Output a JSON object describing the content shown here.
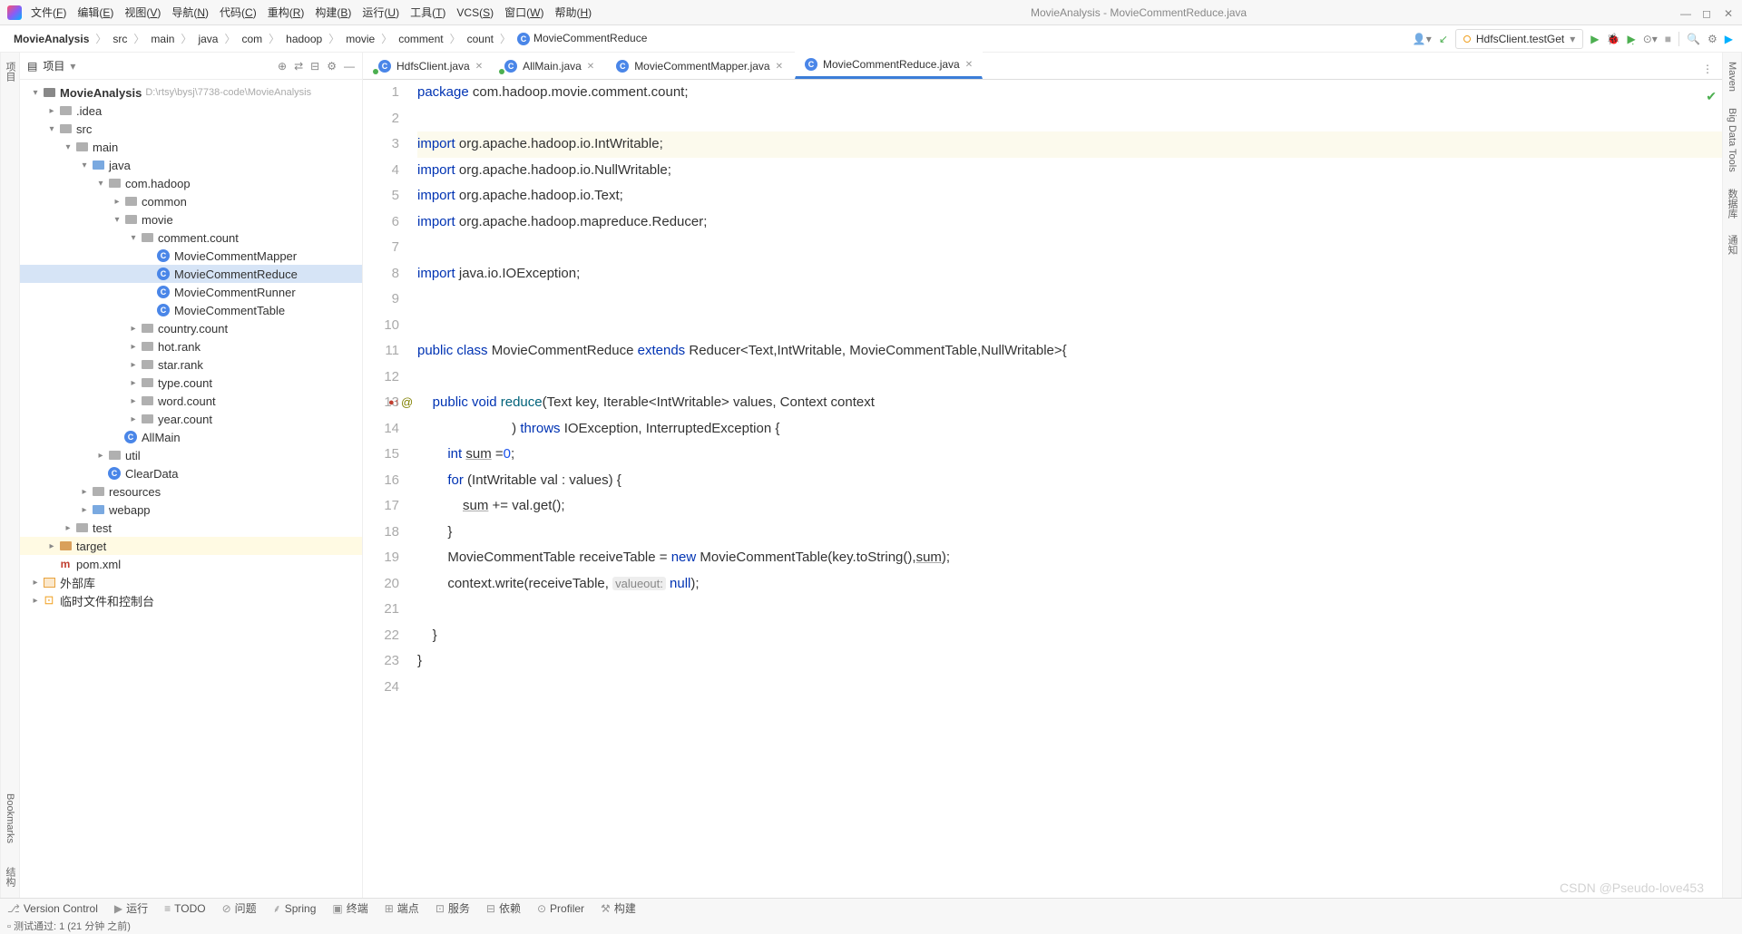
{
  "title": "MovieAnalysis - MovieCommentReduce.java",
  "menu": [
    "文件(F)",
    "编辑(E)",
    "视图(V)",
    "导航(N)",
    "代码(C)",
    "重构(R)",
    "构建(B)",
    "运行(U)",
    "工具(T)",
    "VCS(S)",
    "窗口(W)",
    "帮助(H)"
  ],
  "breadcrumb": [
    "MovieAnalysis",
    "src",
    "main",
    "java",
    "com",
    "hadoop",
    "movie",
    "comment",
    "count",
    "MovieCommentReduce"
  ],
  "runConfig": "HdfsClient.testGet",
  "sidebar": {
    "title": "项目",
    "tree": [
      {
        "d": 0,
        "a": "▾",
        "t": "module",
        "l": "MovieAnalysis",
        "p": "D:\\rtsy\\bysj\\7738-code\\MovieAnalysis",
        "bold": true
      },
      {
        "d": 1,
        "a": "▸",
        "t": "fld",
        "l": ".idea"
      },
      {
        "d": 1,
        "a": "▾",
        "t": "fld",
        "l": "src"
      },
      {
        "d": 2,
        "a": "▾",
        "t": "fld",
        "l": "main"
      },
      {
        "d": 3,
        "a": "▾",
        "t": "fldB",
        "l": "java"
      },
      {
        "d": 4,
        "a": "▾",
        "t": "fld",
        "l": "com.hadoop"
      },
      {
        "d": 5,
        "a": "▸",
        "t": "fld",
        "l": "common"
      },
      {
        "d": 5,
        "a": "▾",
        "t": "fld",
        "l": "movie"
      },
      {
        "d": 6,
        "a": "▾",
        "t": "fld",
        "l": "comment.count"
      },
      {
        "d": 7,
        "a": "",
        "t": "cls",
        "l": "MovieCommentMapper"
      },
      {
        "d": 7,
        "a": "",
        "t": "cls",
        "l": "MovieCommentReduce",
        "sel": true
      },
      {
        "d": 7,
        "a": "",
        "t": "cls",
        "l": "MovieCommentRunner"
      },
      {
        "d": 7,
        "a": "",
        "t": "cls",
        "l": "MovieCommentTable"
      },
      {
        "d": 6,
        "a": "▸",
        "t": "fld",
        "l": "country.count"
      },
      {
        "d": 6,
        "a": "▸",
        "t": "fld",
        "l": "hot.rank"
      },
      {
        "d": 6,
        "a": "▸",
        "t": "fld",
        "l": "star.rank"
      },
      {
        "d": 6,
        "a": "▸",
        "t": "fld",
        "l": "type.count"
      },
      {
        "d": 6,
        "a": "▸",
        "t": "fld",
        "l": "word.count"
      },
      {
        "d": 6,
        "a": "▸",
        "t": "fld",
        "l": "year.count"
      },
      {
        "d": 5,
        "a": "",
        "t": "cls",
        "l": "AllMain"
      },
      {
        "d": 4,
        "a": "▸",
        "t": "fld",
        "l": "util"
      },
      {
        "d": 4,
        "a": "",
        "t": "cls",
        "l": "ClearData"
      },
      {
        "d": 3,
        "a": "▸",
        "t": "fld",
        "l": "resources"
      },
      {
        "d": 3,
        "a": "▸",
        "t": "fldB",
        "l": "webapp"
      },
      {
        "d": 2,
        "a": "▸",
        "t": "fld",
        "l": "test"
      },
      {
        "d": 1,
        "a": "▸",
        "t": "fldO",
        "l": "target",
        "hl": true
      },
      {
        "d": 1,
        "a": "",
        "t": "mvn",
        "l": "pom.xml"
      },
      {
        "d": 0,
        "a": "▸",
        "t": "lib",
        "l": "外部库"
      },
      {
        "d": 0,
        "a": "▸",
        "t": "scratch",
        "l": "临时文件和控制台"
      }
    ]
  },
  "tabs": [
    {
      "l": "HdfsClient.java",
      "run": true
    },
    {
      "l": "AllMain.java",
      "run": true
    },
    {
      "l": "MovieCommentMapper.java"
    },
    {
      "l": "MovieCommentReduce.java",
      "active": true
    }
  ],
  "leftGutter": [
    "项目"
  ],
  "rightGutter": [
    "Maven",
    "Big Data Tools",
    "数据库",
    "通知"
  ],
  "bottomBar": [
    "Version Control",
    "运行",
    "TODO",
    "问题",
    "Spring",
    "终端",
    "端点",
    "服务",
    "依赖",
    "Profiler",
    "构建"
  ],
  "status": "测试通过: 1 (21 分钟 之前)",
  "watermark": "CSDN @Pseudo-love453",
  "code": {
    "1": {
      "pkg": "package",
      "path": " com.hadoop.movie.comment.count;"
    },
    "3": {
      "imp": "import",
      "rest": " org.apache.hadoop.io.IntWritable;"
    },
    "4": {
      "imp": "import",
      "rest": " org.apache.hadoop.io.NullWritable;"
    },
    "5": {
      "imp": "import",
      "rest": " org.apache.hadoop.io.Text;"
    },
    "6": {
      "imp": "import",
      "rest": " org.apache.hadoop.mapreduce.Reducer;"
    },
    "8": {
      "imp": "import",
      "rest": " java.io.IOException;"
    },
    "11": {
      "pub": "public",
      "cls": "class",
      "name": " MovieCommentReduce ",
      "ext": "extends",
      "rest": " Reducer<Text,IntWritable, MovieCommentTable,NullWritable>{"
    },
    "13": {
      "pre": "    ",
      "pub": "public",
      "vd": " void ",
      "name": "reduce",
      "args": "(Text key, Iterable<IntWritable> values, Context context"
    },
    "14": {
      "pre": "                         ) ",
      "thr": "throws",
      "rest": " IOException, InterruptedException {"
    },
    "15": {
      "pre": "        ",
      "int": "int ",
      "sum": "sum",
      "eq": " =",
      "zero": "0",
      "semi": ";"
    },
    "16": {
      "pre": "        ",
      "for": "for",
      "rest": " (IntWritable val : values) {"
    },
    "17": {
      "pre": "            ",
      "sum": "sum",
      "rest": " += val.get();"
    },
    "18": {
      "pre": "        }"
    },
    "19": {
      "pre": "        MovieCommentTable receiveTable = ",
      "new": "new",
      "rest1": " MovieCommentTable(key.toString(),",
      "sum": "sum",
      "rest2": ");"
    },
    "20": {
      "pre": "        context.write(receiveTable, ",
      "hint": "valueout:",
      "nul": " null",
      "rest": ");"
    },
    "22": {
      "pre": "    }"
    },
    "23": {
      "pre": "}"
    }
  }
}
